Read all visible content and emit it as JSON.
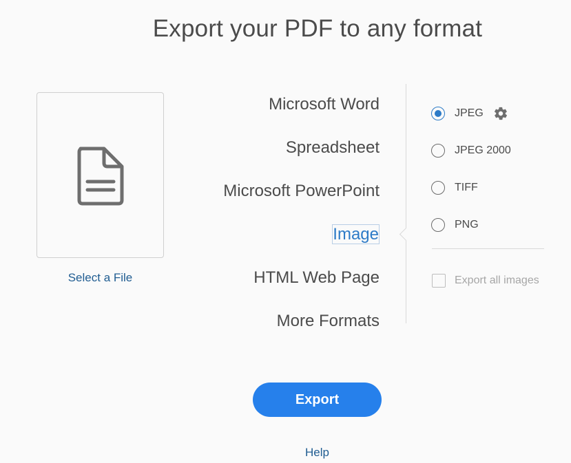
{
  "page": {
    "title": "Export your PDF to any format"
  },
  "file_panel": {
    "icon": "document-icon",
    "select_label": "Select a File"
  },
  "formats": {
    "items": [
      {
        "label": "Microsoft Word",
        "selected": false
      },
      {
        "label": "Spreadsheet",
        "selected": false
      },
      {
        "label": "Microsoft PowerPoint",
        "selected": false
      },
      {
        "label": "Image",
        "selected": true
      },
      {
        "label": "HTML Web Page",
        "selected": false
      },
      {
        "label": "More Formats",
        "selected": false
      }
    ]
  },
  "image_options": {
    "radios": [
      {
        "label": "JPEG",
        "checked": true
      },
      {
        "label": "JPEG 2000",
        "checked": false
      },
      {
        "label": "TIFF",
        "checked": false
      },
      {
        "label": "PNG",
        "checked": false
      }
    ],
    "settings_icon": "gear-icon",
    "export_all_label": "Export all images",
    "export_all_checked": false,
    "export_all_enabled": false
  },
  "actions": {
    "export_label": "Export",
    "help_label": "Help"
  },
  "colors": {
    "accent": "#2680eb",
    "link": "#1f5c91",
    "selected_text": "#2d7bc7",
    "background": "#fafafa"
  }
}
